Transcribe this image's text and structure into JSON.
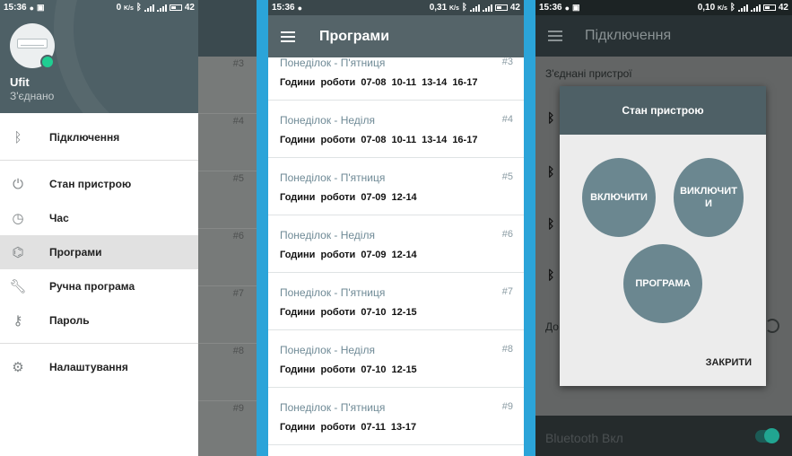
{
  "status_bars": [
    {
      "time": "15:36",
      "speed": "0 ",
      "speed_unit": "K/s",
      "battery": "42"
    },
    {
      "time": "15:36",
      "speed": "0,31",
      "speed_unit": "K/s",
      "battery": "42"
    },
    {
      "time": "15:36",
      "speed": "0,10",
      "speed_unit": "K/s",
      "battery": "42"
    }
  ],
  "drawer": {
    "device_name": "Ufit",
    "device_status": "З'єднано",
    "items": [
      {
        "label": "Підключення",
        "icon": "bluetooth-icon"
      },
      {
        "label": "Стан пристрою",
        "icon": "power-icon"
      },
      {
        "label": "Час",
        "icon": "clock-icon"
      },
      {
        "label": "Програми",
        "icon": "programs-icon",
        "active": true
      },
      {
        "label": "Ручна програма",
        "icon": "wrench-icon"
      },
      {
        "label": "Пароль",
        "icon": "key-icon"
      },
      {
        "label": "Налаштування",
        "icon": "gear-icon"
      }
    ],
    "background_numbers": [
      "#3",
      "#4",
      "#5",
      "#6",
      "#7",
      "#8",
      "#9"
    ]
  },
  "programs": {
    "title": "Програми",
    "items": [
      {
        "days": "Понеділок - П'ятниця",
        "num": "#3",
        "hours": "Години роботи 07-08 10-11 13-14 16-17"
      },
      {
        "days": "Понеділок - Неділя",
        "num": "#4",
        "hours": "Години роботи 07-08 10-11 13-14 16-17"
      },
      {
        "days": "Понеділок - П'ятниця",
        "num": "#5",
        "hours": "Години роботи 07-09 12-14"
      },
      {
        "days": "Понеділок - Неділя",
        "num": "#6",
        "hours": "Години роботи 07-09 12-14"
      },
      {
        "days": "Понеділок - П'ятниця",
        "num": "#7",
        "hours": "Години роботи 07-10 12-15"
      },
      {
        "days": "Понеділок - Неділя",
        "num": "#8",
        "hours": "Години роботи 07-10 12-15"
      },
      {
        "days": "Понеділок - П'ятниця",
        "num": "#9",
        "hours": "Години роботи 07-11 13-17"
      }
    ]
  },
  "connection": {
    "title": "Підключення",
    "connected_title": "З'єднані пристрої",
    "do_label": "До",
    "bluetooth_status": "Bluetooth Вкл",
    "dialog": {
      "title": "Стан пристрою",
      "on_label": "ВКЛЮЧИТИ",
      "off_label_1": "ВИКЛЮЧИТ",
      "off_label_2": "И",
      "program_label": "ПРОГРАМА",
      "close_label": "ЗАКРИТИ"
    }
  },
  "colors": {
    "accent": "#2ba4d9",
    "appbar": "#556469",
    "dialog_header": "#4e6066",
    "circle": "#6b8790",
    "online": "#1fce92"
  }
}
